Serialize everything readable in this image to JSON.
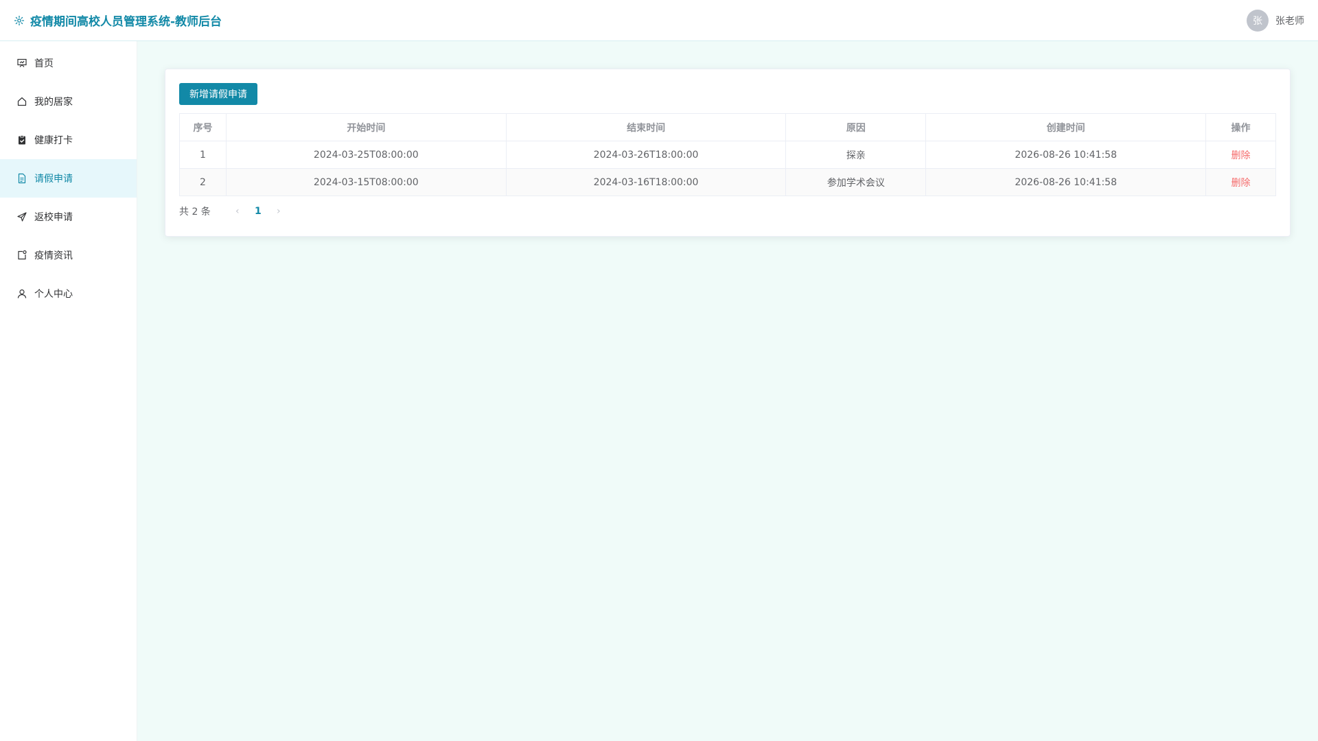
{
  "header": {
    "title": "疫情期间高校人员管理系统-教师后台",
    "avatar_text": "张",
    "user_name": "张老师"
  },
  "sidebar": {
    "items": [
      {
        "label": "首页",
        "icon": "presentation-icon"
      },
      {
        "label": "我的居家",
        "icon": "home-icon"
      },
      {
        "label": "健康打卡",
        "icon": "clipboard-check-icon"
      },
      {
        "label": "请假申请",
        "icon": "document-icon",
        "active": true
      },
      {
        "label": "返校申请",
        "icon": "send-icon"
      },
      {
        "label": "疫情资讯",
        "icon": "news-icon"
      },
      {
        "label": "个人中心",
        "icon": "user-icon"
      }
    ]
  },
  "main": {
    "add_button": "新增请假申请",
    "table": {
      "columns": [
        "序号",
        "开始时间",
        "结束时间",
        "原因",
        "创建时间",
        "操作"
      ],
      "rows": [
        {
          "index": "1",
          "start": "2024-03-25T08:00:00",
          "end": "2024-03-26T18:00:00",
          "reason": "探亲",
          "created": "2026-08-26 10:41:58",
          "action": "删除"
        },
        {
          "index": "2",
          "start": "2024-03-15T08:00:00",
          "end": "2024-03-16T18:00:00",
          "reason": "参加学术会议",
          "created": "2026-08-26 10:41:58",
          "action": "删除"
        }
      ]
    },
    "pagination": {
      "total": "共 2 条",
      "prev": "‹",
      "current": "1",
      "next": "›"
    }
  },
  "colors": {
    "accent": "#1289a7",
    "danger": "#f56c6c",
    "page_bg": "#f0fbf9",
    "active_bg": "#e6f7fb"
  }
}
